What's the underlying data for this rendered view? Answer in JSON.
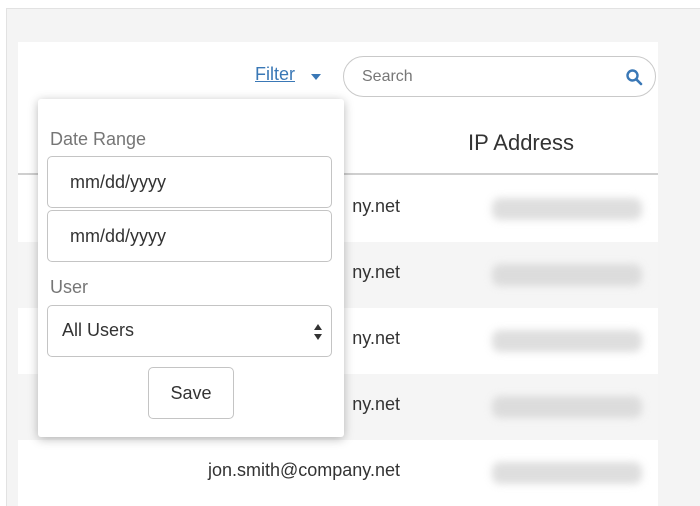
{
  "toolbar": {
    "filter_label": "Filter",
    "search_placeholder": "Search"
  },
  "table": {
    "columns": [
      "IP Address"
    ],
    "rows": [
      {
        "email": "ny.net"
      },
      {
        "email": "ny.net"
      },
      {
        "email": "ny.net"
      },
      {
        "email": "ny.net"
      },
      {
        "email": "jon.smith@company.net"
      }
    ]
  },
  "filter_dropdown": {
    "date_range_label": "Date Range",
    "date_start_placeholder": "mm/dd/yyyy",
    "date_end_placeholder": "mm/dd/yyyy",
    "user_label": "User",
    "user_selected": "All Users",
    "save_label": "Save"
  },
  "colors": {
    "link": "#3a78b6",
    "text": "#333333",
    "label": "#767676",
    "row_alt": "#f5f5f5"
  },
  "icons": [
    "chevron-down-icon",
    "search-icon",
    "select-arrows-icon"
  ]
}
